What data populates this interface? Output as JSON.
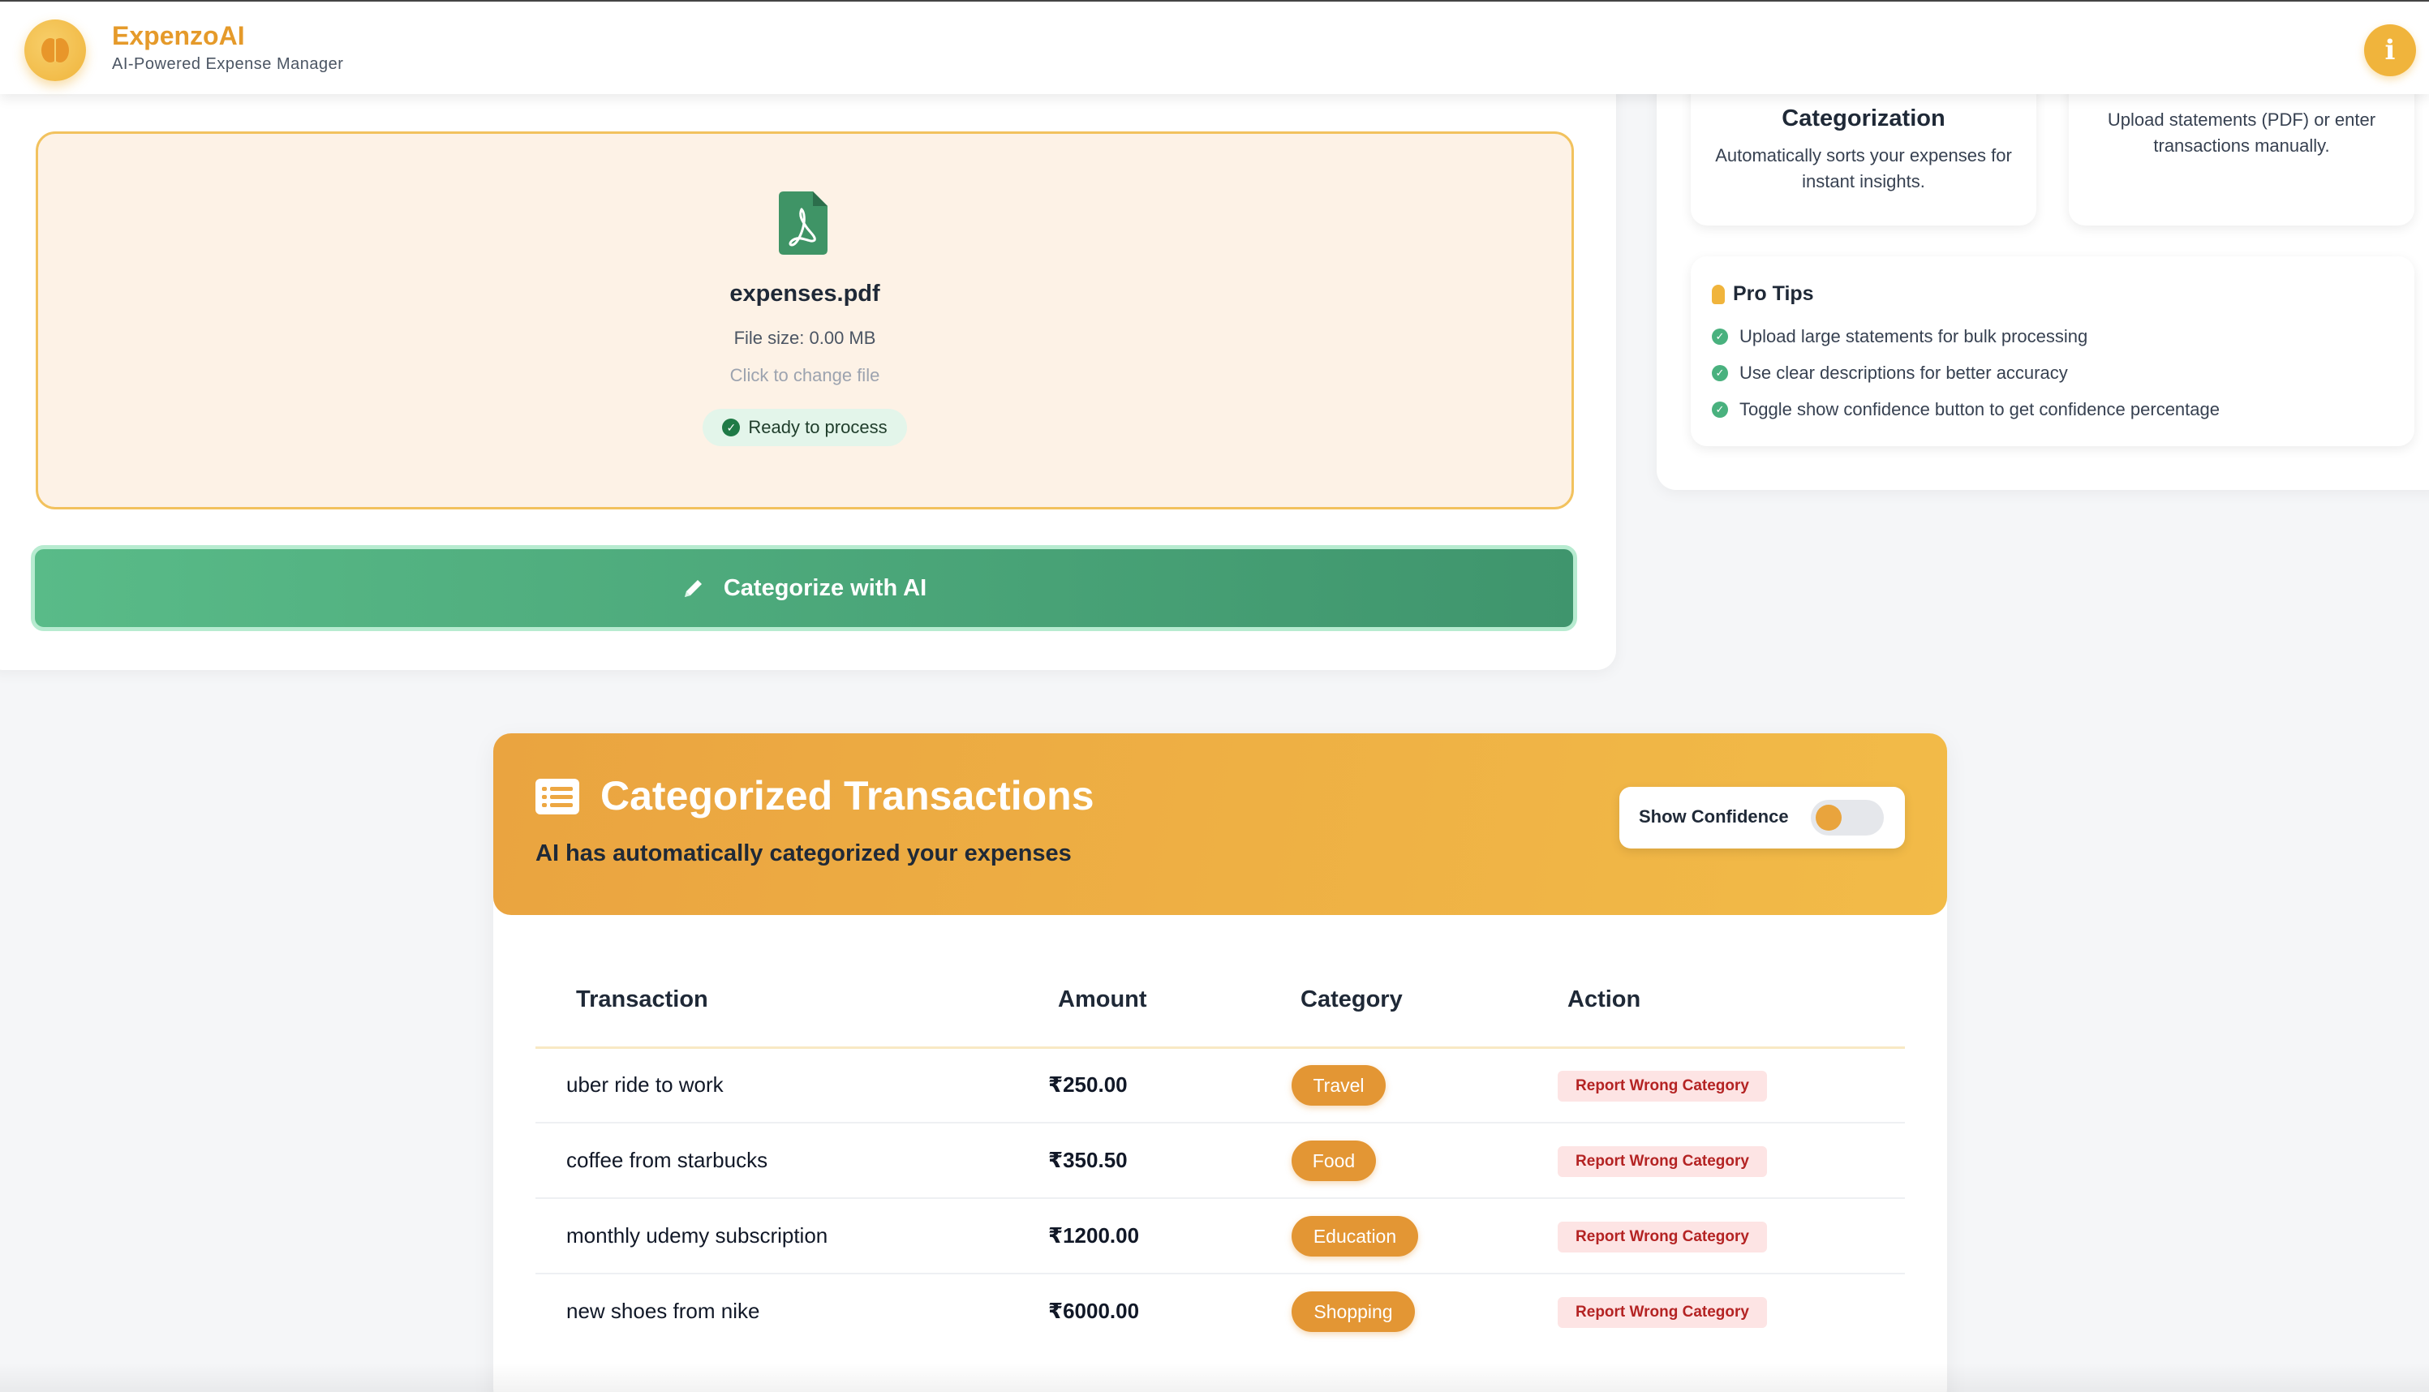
{
  "header": {
    "brand_name": "ExpenzoAI",
    "brand_subtitle": "AI-Powered Expense Manager",
    "info_label": "i",
    "logo_icon": "brain-icon",
    "brand_color": "#e59a2a"
  },
  "upload": {
    "file_icon": "pdf-file-icon",
    "file_name": "expenses.pdf",
    "file_size": "File size: 0.00 MB",
    "change_hint": "Click to change file",
    "status": "Ready to process",
    "button_label": "Categorize with AI",
    "button_icon": "pencil-icon"
  },
  "features": [
    {
      "title": "Categorization",
      "description": "Automatically sorts your expenses for instant insights."
    },
    {
      "title": "",
      "description": "Upload statements (PDF) or enter transactions manually."
    }
  ],
  "tips": {
    "title": "Pro Tips",
    "items": [
      "Upload large statements for bulk processing",
      "Use clear descriptions for better accuracy",
      "Toggle show confidence button to get confidence percentage"
    ]
  },
  "transactions": {
    "title": "Categorized Transactions",
    "subtitle": "AI has automatically categorized your expenses",
    "icon": "list-icon",
    "confidence_label": "Show Confidence",
    "confidence_on": false,
    "columns": [
      "Transaction",
      "Amount",
      "Category",
      "Action"
    ],
    "rows": [
      {
        "description": "uber ride to work",
        "amount": "₹250.00",
        "category": "Travel",
        "action": "Report Wrong Category"
      },
      {
        "description": "coffee from starbucks",
        "amount": "₹350.50",
        "category": "Food",
        "action": "Report Wrong Category"
      },
      {
        "description": "monthly udemy subscription",
        "amount": "₹1200.00",
        "category": "Education",
        "action": "Report Wrong Category"
      },
      {
        "description": "new shoes from nike",
        "amount": "₹6000.00",
        "category": "Shopping",
        "action": "Report Wrong Category"
      }
    ],
    "accent_color": "#e39634"
  }
}
